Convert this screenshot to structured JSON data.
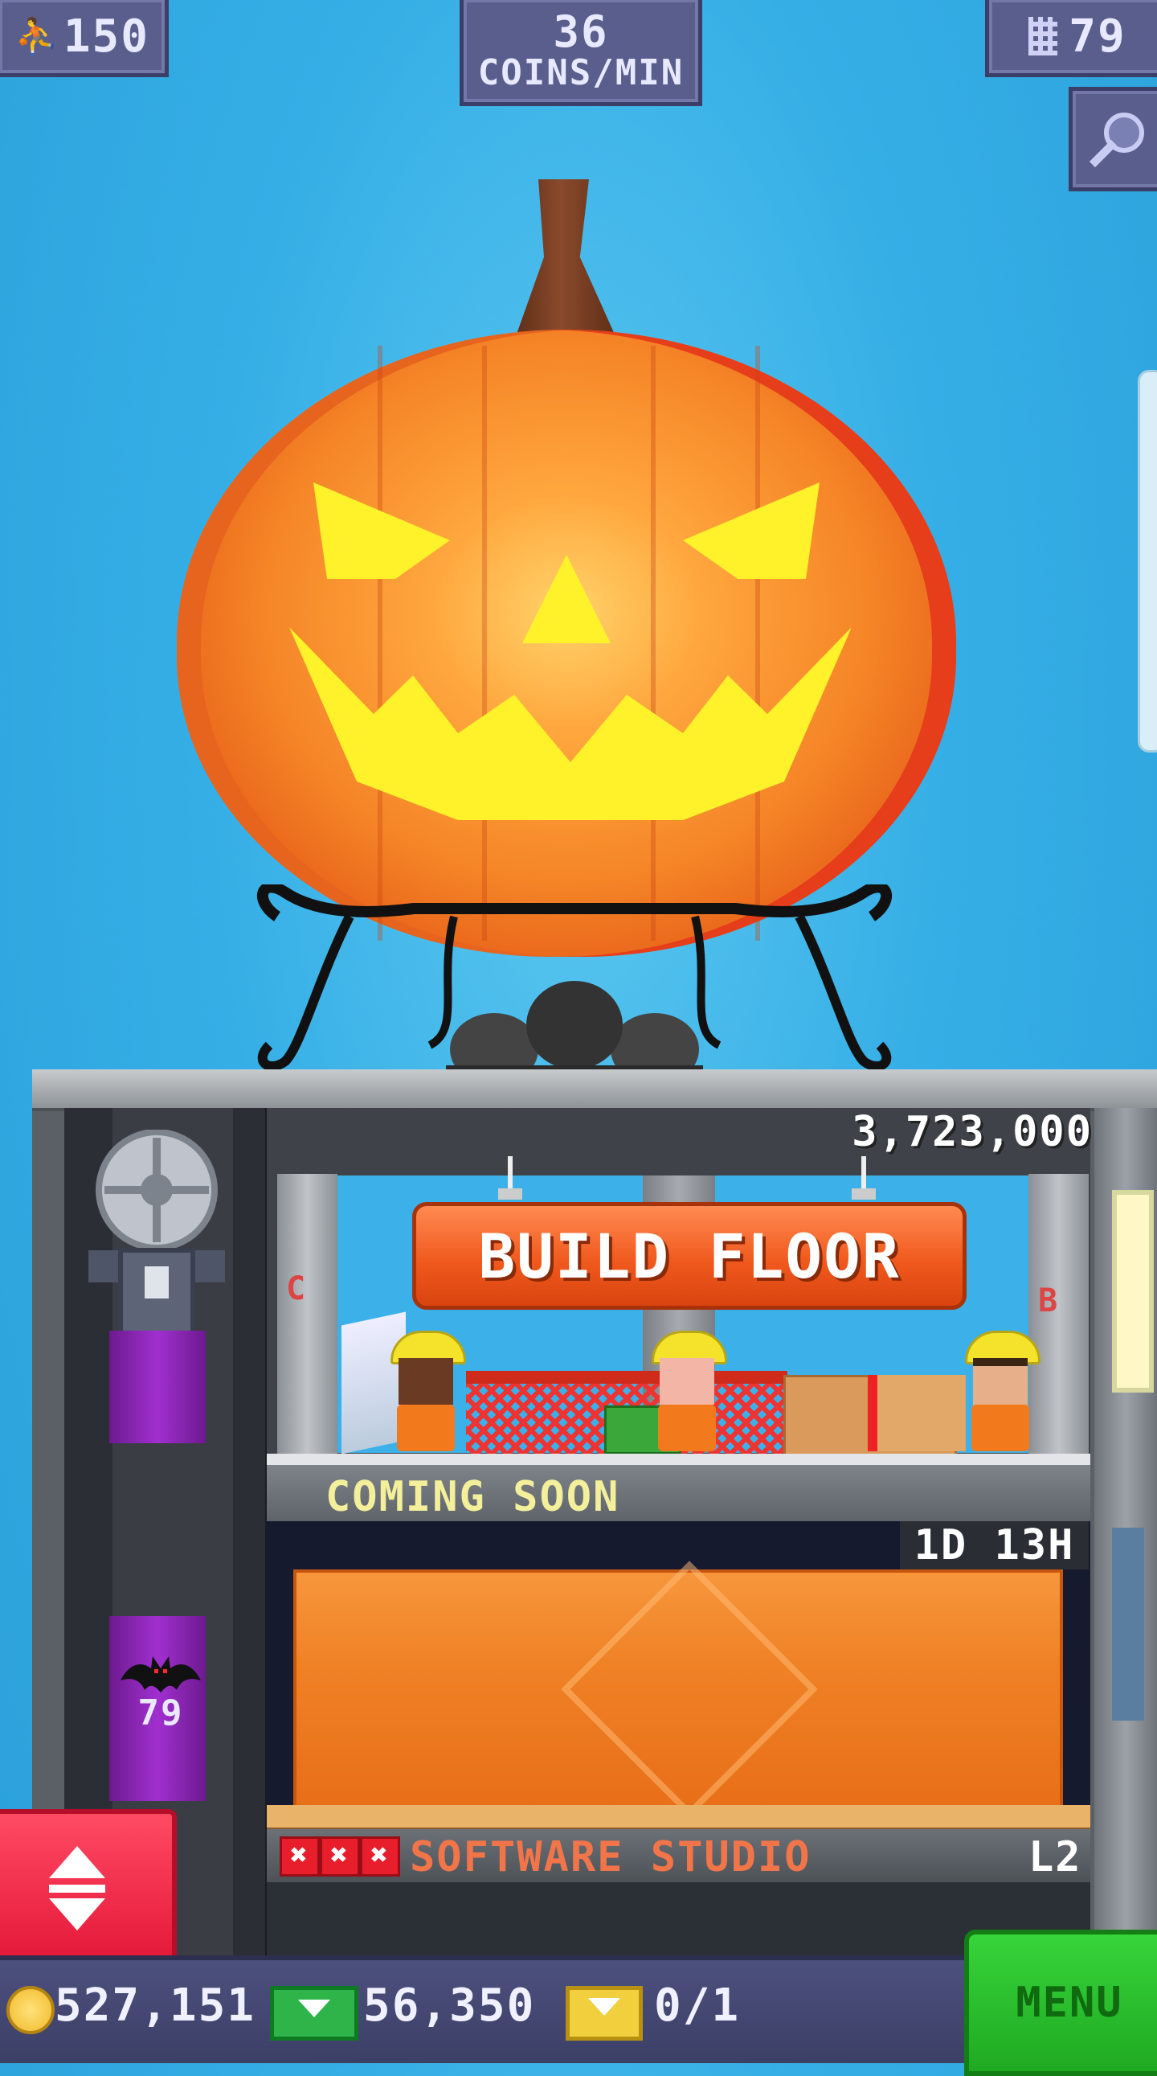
{
  "hud": {
    "population": "150",
    "coins_per_min_value": "36",
    "coins_per_min_label": "COINS/MIN",
    "floors": "79"
  },
  "tower": {
    "build_price": "3,723,000",
    "build_button": "BUILD FLOOR",
    "left_letter": "C",
    "right_letter": "B",
    "coming_soon": "COMING SOON",
    "timer": "1D 13H",
    "elevator_floor": "79",
    "studio_marks": [
      "✖",
      "✖",
      "✖"
    ],
    "studio_name": "SOFTWARE STUDIO",
    "studio_level": "L2"
  },
  "bottom": {
    "coins": "527,151",
    "bux": "56,350",
    "tickets": "0/1",
    "menu": "MENU"
  },
  "colors": {
    "sky": "#35aee6",
    "build_button": "#f05a1e",
    "menu_button": "#2cbf2f",
    "elevator_button": "#e5193a"
  }
}
